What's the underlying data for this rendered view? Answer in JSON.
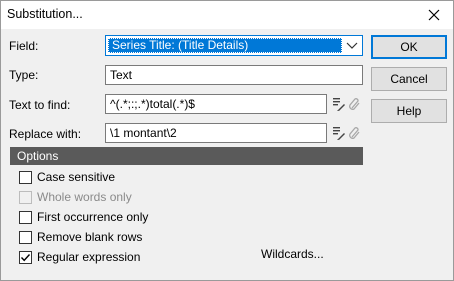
{
  "dialog": {
    "title": "Substitution..."
  },
  "fields": {
    "field_label": "Field:",
    "field_value": "Series Title: (Title Details)",
    "type_label": "Type:",
    "type_value": "Text",
    "find_label": "Text to find:",
    "find_value": "^(.*;:;.*)total(.*)$",
    "replace_label": "Replace with:",
    "replace_value": "\\1 montant\\2"
  },
  "buttons": {
    "ok": "OK",
    "cancel": "Cancel",
    "help": "Help"
  },
  "options": {
    "header": "Options",
    "items": [
      {
        "label": "Case sensitive",
        "checked": false,
        "disabled": false
      },
      {
        "label": "Whole words only",
        "checked": false,
        "disabled": true
      },
      {
        "label": "First occurrence only",
        "checked": false,
        "disabled": false
      },
      {
        "label": "Remove blank rows",
        "checked": false,
        "disabled": false
      },
      {
        "label": "Regular expression",
        "checked": true,
        "disabled": false
      }
    ],
    "wildcards": "Wildcards..."
  },
  "icons": {
    "close": "close-icon",
    "dropdown": "chevron-down-icon",
    "edit": "edit-pencil-icon",
    "attach": "paperclip-icon"
  },
  "colors": {
    "accent": "#0078d7",
    "options_header_bg": "#5a5a5a"
  }
}
